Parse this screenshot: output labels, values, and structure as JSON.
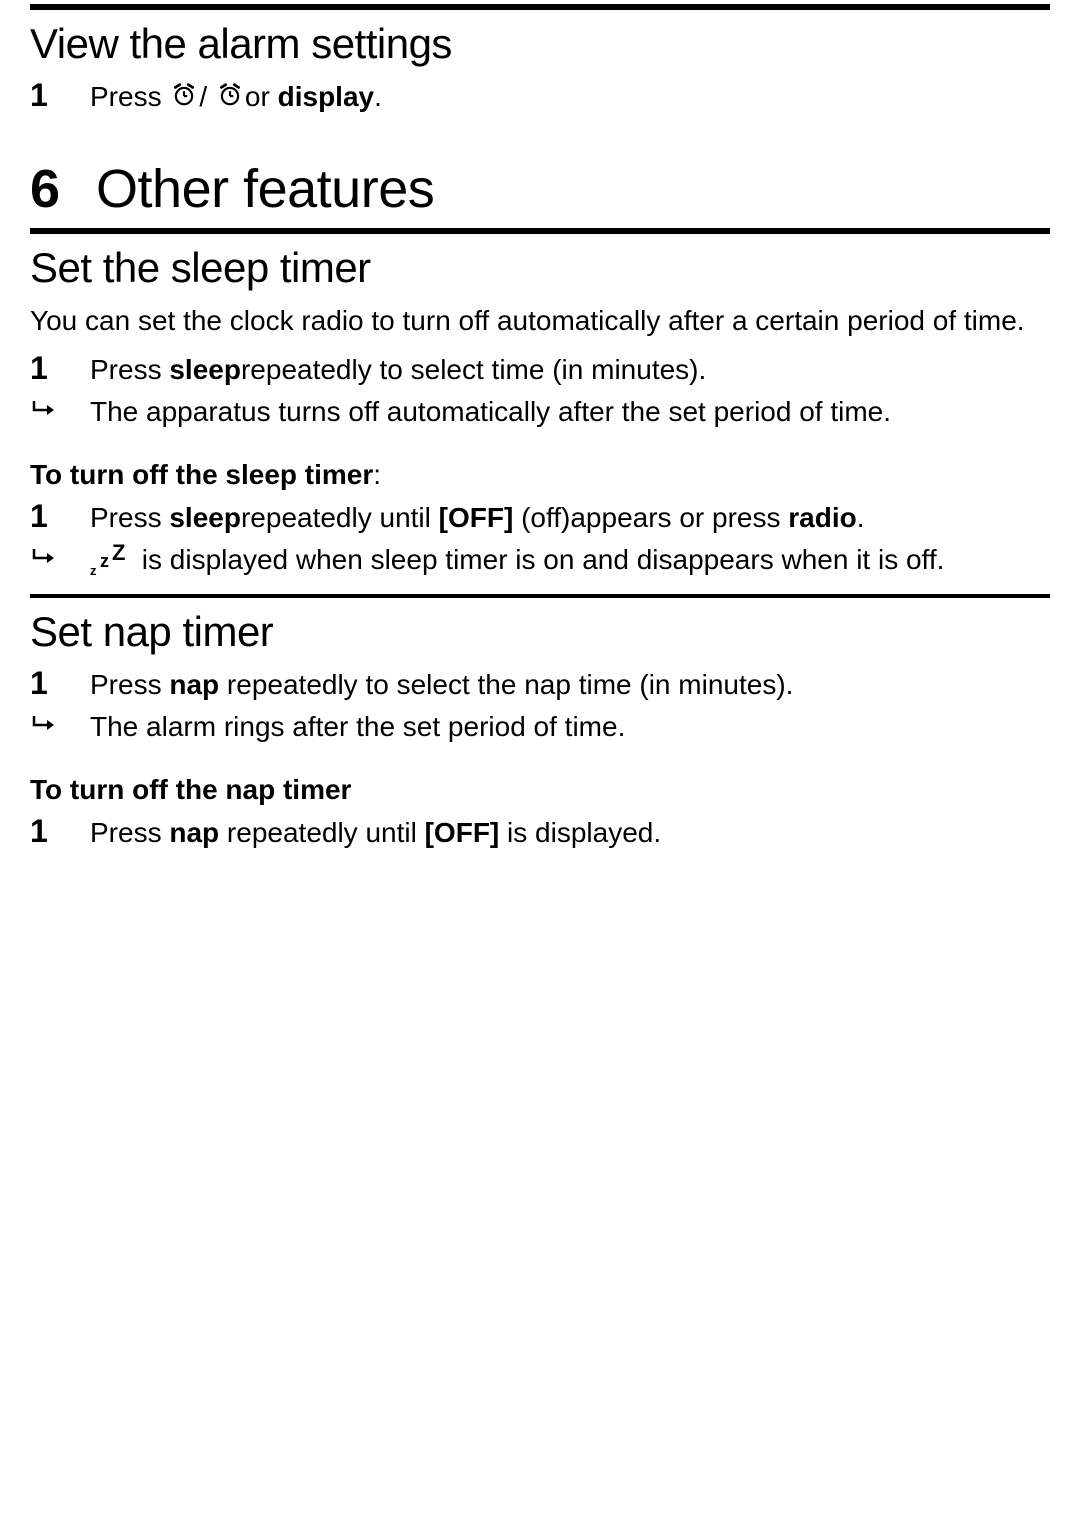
{
  "section1": {
    "title": "View the alarm settings",
    "step1_num": "1",
    "step1_press": "Press",
    "step1_sep": "/",
    "step1_or": "or ",
    "step1_display": "display",
    "step1_period": "."
  },
  "chapter": {
    "num": "6",
    "title": "Other features"
  },
  "section2": {
    "title": "Set the sleep timer",
    "intro": "You can set the clock radio to turn off automatically after a certain period of time.",
    "step1_num": "1",
    "step1_a": "Press ",
    "step1_b": "sleep",
    "step1_c": "repeatedly to select time (in minutes).",
    "result1": "The apparatus turns off automatically after the set period of time.",
    "sub": "To turn off the sleep timer",
    "sub_colon": ":",
    "step2_num": "1",
    "step2_a": "Press ",
    "step2_b": "sleep",
    "step2_c": "repeatedly until ",
    "step2_d": "[OFF]",
    "step2_e": " (off)appears or press ",
    "step2_f": "radio",
    "step2_g": ".",
    "zzz_z1": "z",
    "zzz_z2": "z",
    "zzz_z3": "Z",
    "result2": " is displayed when sleep timer is on and disappears when it is off."
  },
  "section3": {
    "title": "Set nap timer",
    "step1_num": "1",
    "step1_a": "Press ",
    "step1_b": "nap",
    "step1_c": " repeatedly to select the nap time (in minutes).",
    "result1": "The alarm rings after the set period of time.",
    "sub": "To turn off the nap timer",
    "step2_num": "1",
    "step2_a": "Press ",
    "step2_b": "nap",
    "step2_c": " repeatedly until ",
    "step2_d": "[OFF]",
    "step2_e": " is displayed."
  }
}
